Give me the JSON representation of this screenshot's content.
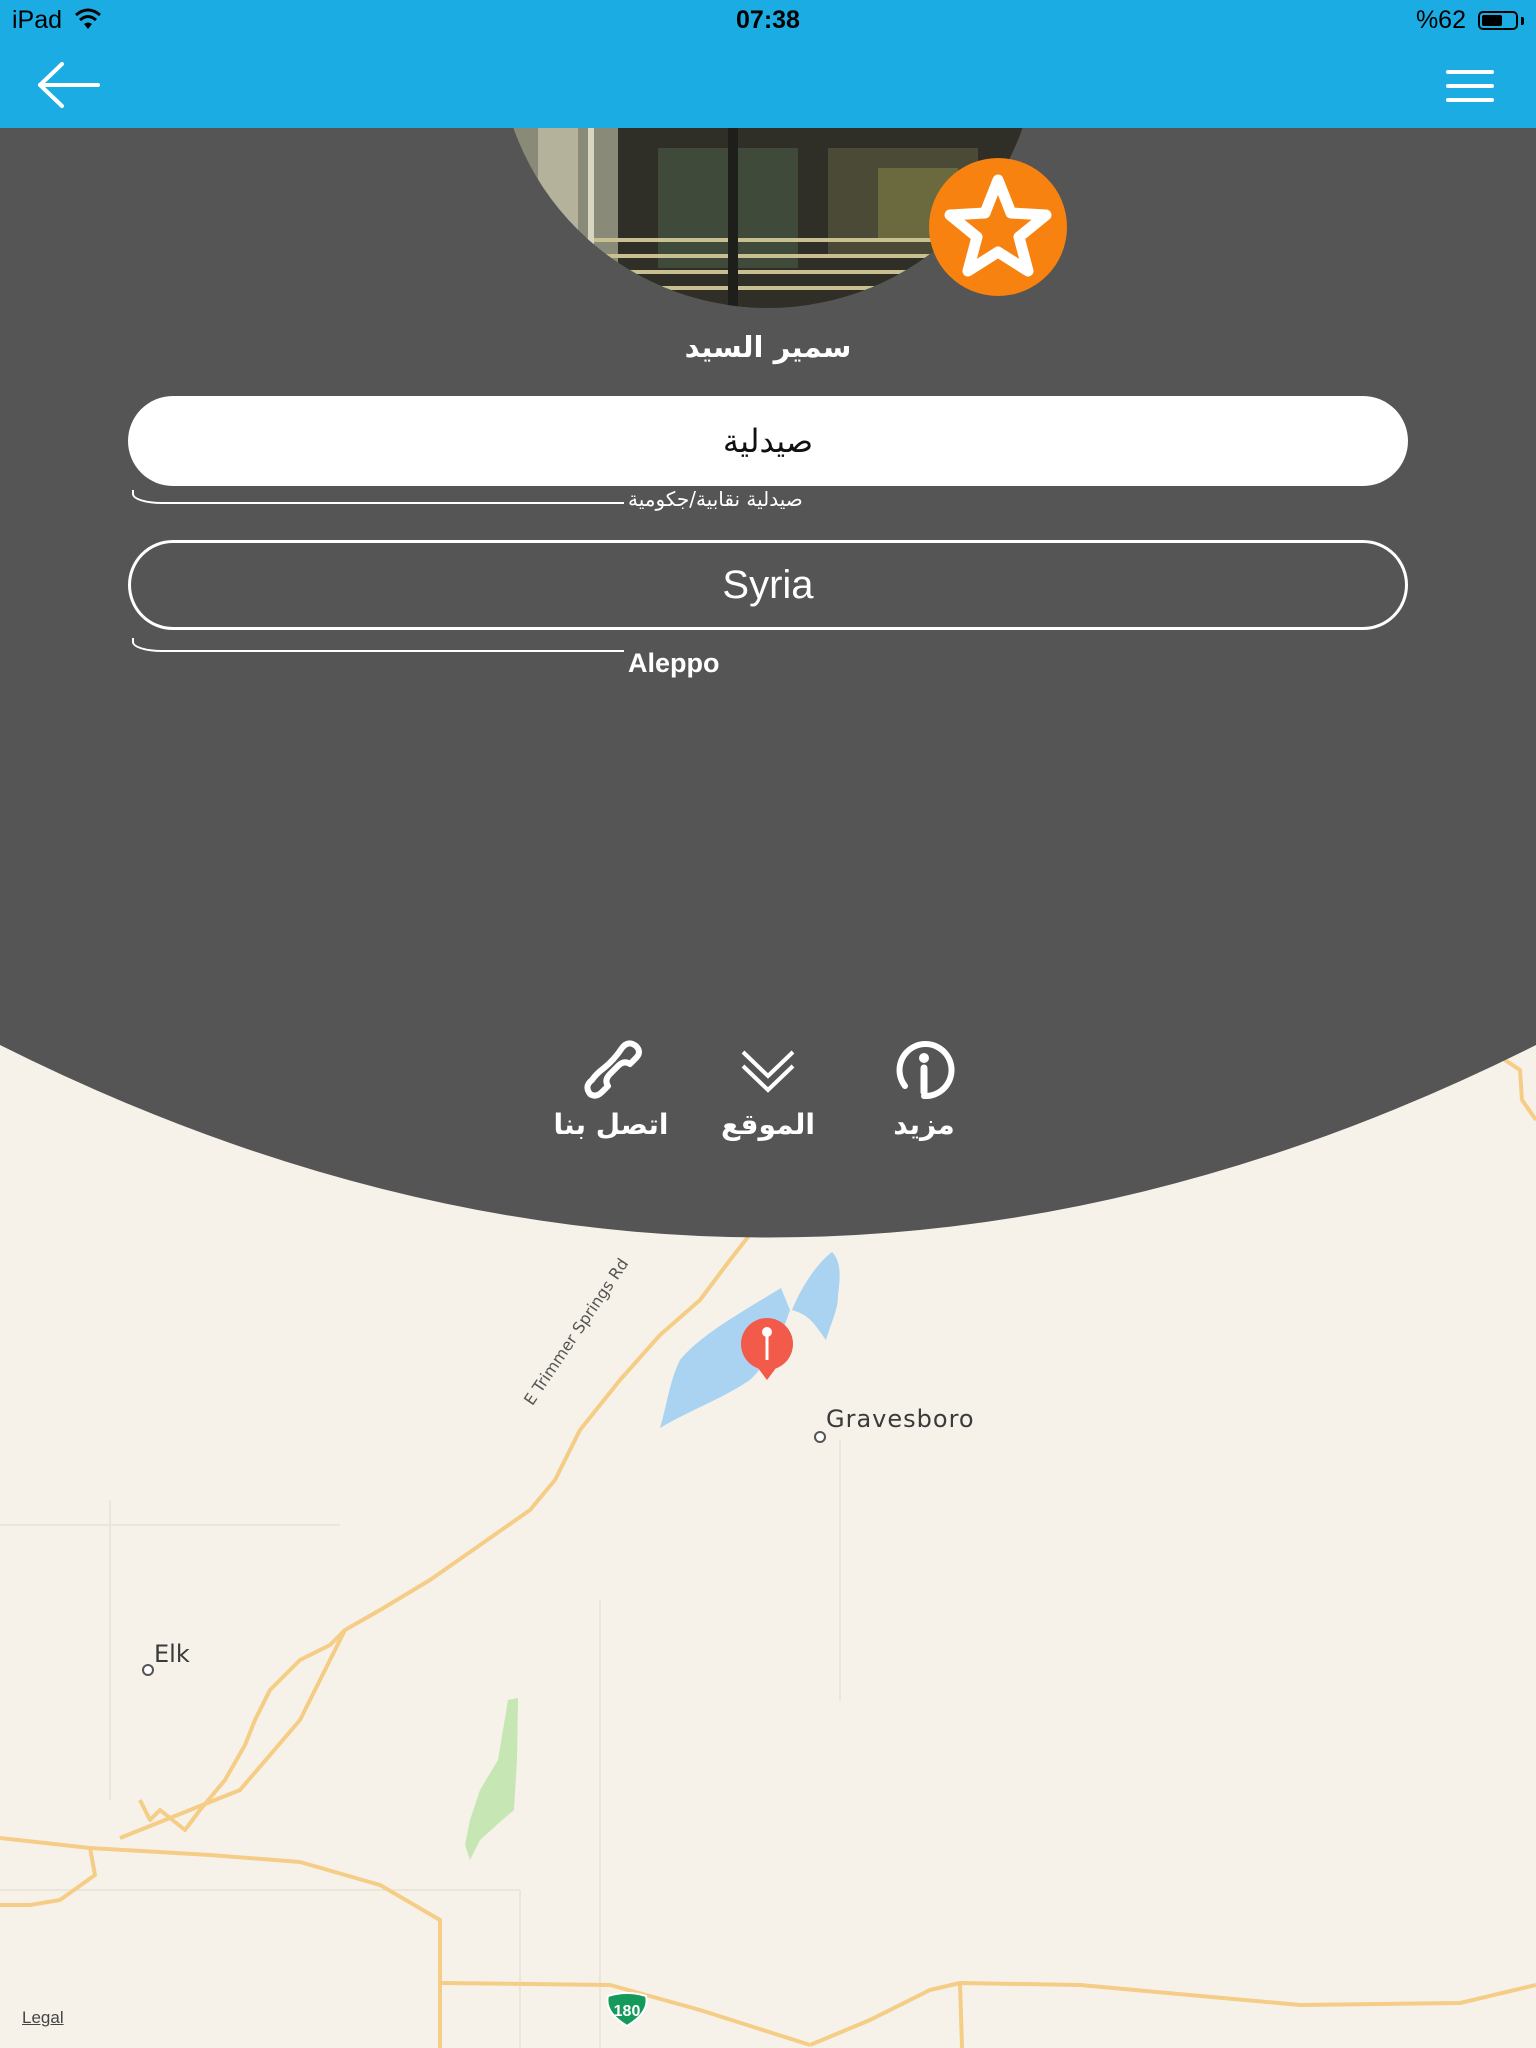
{
  "status_bar": {
    "device": "iPad",
    "time": "07:38",
    "battery_pct": "%62",
    "battery_level": 0.62
  },
  "nav": {
    "back_icon": "back-arrow-icon",
    "menu_icon": "hamburger-menu-icon"
  },
  "profile": {
    "name": "سمير السيد",
    "favorite_icon": "star-icon",
    "category": "صيدلية",
    "category_sub": "صيدلية نقابية/جكومية",
    "country": "Syria",
    "city": "Aleppo"
  },
  "actions": [
    {
      "label": "اتصل بنا",
      "icon": "phone-icon"
    },
    {
      "label": "الموقع",
      "icon": "chevron-down-icon"
    },
    {
      "label": "مزيد",
      "icon": "info-icon"
    }
  ],
  "map": {
    "places": [
      "Gravesboro",
      "Elk"
    ],
    "road": "E Trimmer Springs Rd",
    "route_shield": "180",
    "legal": "Legal"
  },
  "colors": {
    "header": "#1aace3",
    "panel": "#555555",
    "accent": "#f7820f",
    "map_bg": "#f6f2ea",
    "road": "#f5cd86",
    "water": "#a9d3f0",
    "park": "#c6e6b4",
    "pin": "#f25a4a"
  }
}
